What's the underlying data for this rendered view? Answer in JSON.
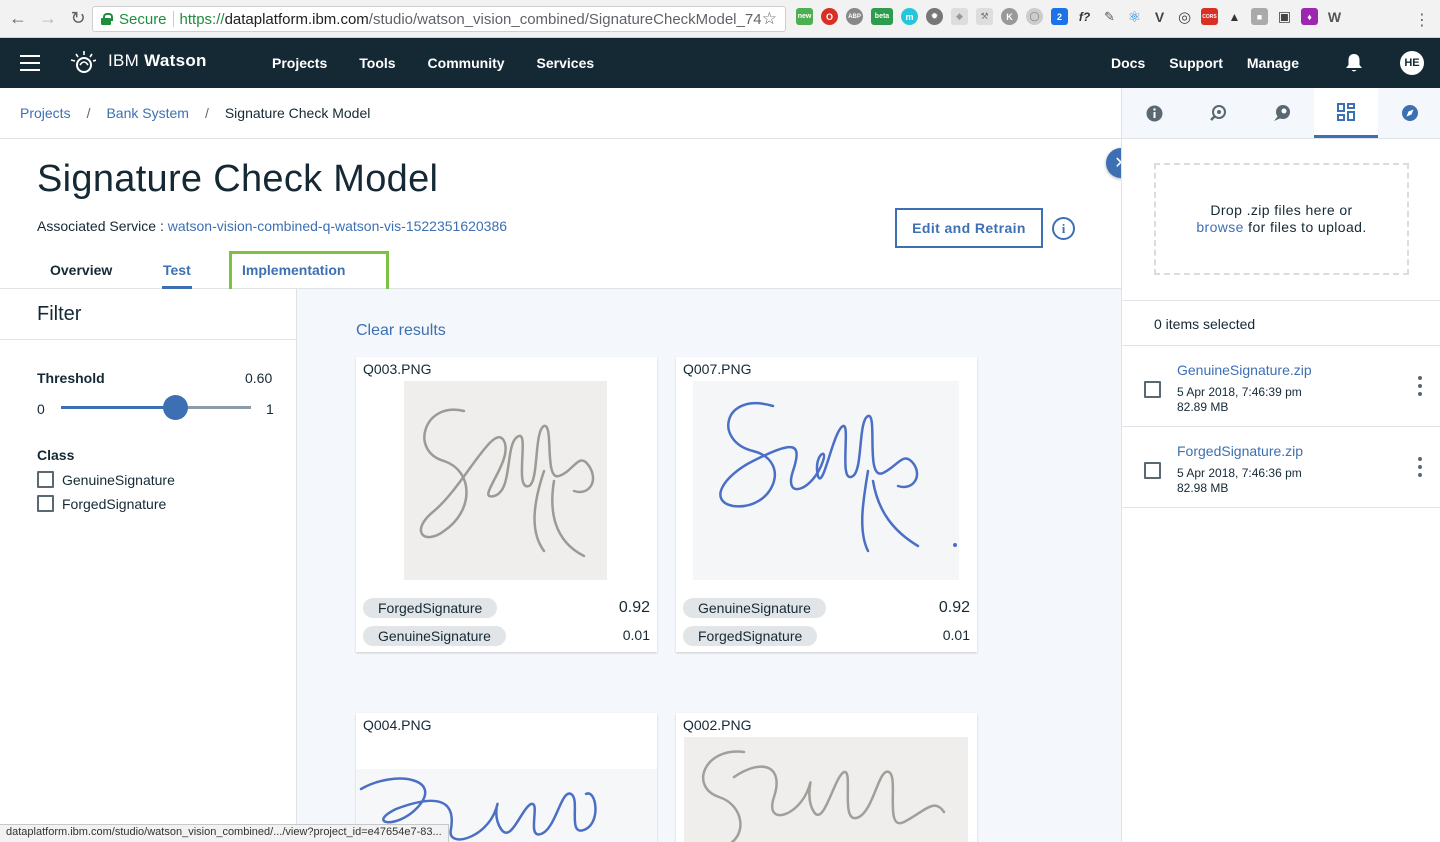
{
  "browser": {
    "secure_label": "Secure",
    "url_scheme": "https://",
    "url_host": "dataplatform.ibm.com",
    "url_path": "/studio/watson_vision_combined/SignatureCheckModel_74...",
    "status_url": "dataplatform.ibm.com/studio/watson_vision_combined/.../view?project_id=e47654e7-83...",
    "ext_badges": {
      "new": "new",
      "abp": "ABP",
      "beta": "beta",
      "count": "2",
      "fx": "f?",
      "cors": "CORS"
    }
  },
  "header": {
    "brand_ibm": "IBM",
    "brand_watson": "Watson",
    "nav": [
      "Projects",
      "Tools",
      "Community",
      "Services"
    ],
    "right_nav": [
      "Docs",
      "Support",
      "Manage"
    ],
    "avatar": "HE"
  },
  "breadcrumb": {
    "items": [
      "Projects",
      "Bank System",
      "Signature Check Model"
    ]
  },
  "page": {
    "title": "Signature Check Model",
    "assoc_label": "Associated Service :",
    "assoc_service": "watson-vision-combined-q-watson-vis-1522351620386",
    "edit_button": "Edit and Retrain",
    "info_glyph": "i",
    "tabs": [
      "Overview",
      "Test",
      "Implementation"
    ]
  },
  "filter": {
    "heading": "Filter",
    "threshold_label": "Threshold",
    "threshold_value": "0.60",
    "threshold_fraction": 0.6,
    "slider_min": "0",
    "slider_max": "1",
    "class_label": "Class",
    "classes": [
      "GenuineSignature",
      "ForgedSignature"
    ]
  },
  "results": {
    "clear_label": "Clear results",
    "cards": [
      {
        "name": "Q003.PNG",
        "preds": [
          {
            "label": "ForgedSignature",
            "score": "0.92"
          },
          {
            "label": "GenuineSignature",
            "score": "0.01"
          }
        ]
      },
      {
        "name": "Q007.PNG",
        "preds": [
          {
            "label": "GenuineSignature",
            "score": "0.92"
          },
          {
            "label": "ForgedSignature",
            "score": "0.01"
          }
        ]
      },
      {
        "name": "Q004.PNG"
      },
      {
        "name": "Q002.PNG"
      }
    ]
  },
  "right_panel": {
    "drop_text_1": "Drop .zip files here or",
    "drop_browse": "browse",
    "drop_text_2": " for files to upload.",
    "items_selected": "0 items selected",
    "files": [
      {
        "name": "GenuineSignature.zip",
        "date": "5 Apr 2018, 7:46:39 pm",
        "size": "82.89 MB"
      },
      {
        "name": "ForgedSignature.zip",
        "date": "5 Apr 2018, 7:46:36 pm",
        "size": "82.98 MB"
      }
    ]
  },
  "colors": {
    "accent": "#3d70b2",
    "header_bg": "#152935",
    "highlight": "#7cc142"
  }
}
